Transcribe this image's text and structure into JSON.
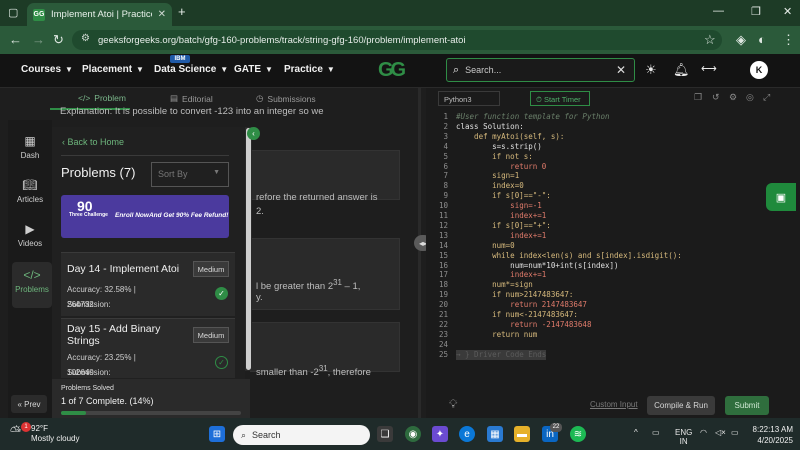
{
  "browser": {
    "tab_title": "Implement Atoi | Practice | GeeksforGeeks",
    "tab_title_display": "Implement Atoi | Practice | Gee",
    "url": "geeksforgeeks.org/batch/gfg-160-problems/track/string-gfg-160/problem/implement-atoi"
  },
  "header": {
    "menu": [
      "Courses",
      "Placement",
      "Data Science",
      "GATE",
      "Practice"
    ],
    "ibm_badge": "IBM",
    "logo": "GG",
    "search_placeholder": "Search...",
    "avatar_letter": "K"
  },
  "problem_tabs": [
    "Problem",
    "Editorial",
    "Submissions"
  ],
  "problem_text": {
    "explanation": "Explanation: It is possible to convert -123 into an integer so we",
    "frag1": "refore the returned answer is",
    "frag1b": "2.",
    "frag2a": "l be greater than 2",
    "frag2sup": "31",
    "frag2b": " – 1,",
    "frag2c": "y.",
    "frag3a": "smaller than -2",
    "frag3sup": "31",
    "frag3b": ", therefore"
  },
  "rail": {
    "items": [
      {
        "label": "Dash",
        "icon": "dashboard-icon"
      },
      {
        "label": "Articles",
        "icon": "articles-icon"
      },
      {
        "label": "Videos",
        "icon": "videos-icon"
      },
      {
        "label": "Problems",
        "icon": "code-icon"
      }
    ],
    "prev_label": "« Prev"
  },
  "panel": {
    "back_label": "Back to Home",
    "title": "Problems (7)",
    "sort_placeholder": "Sort By",
    "banner": {
      "big": "90",
      "small": "Three Challenge",
      "text": "Enroll NowAnd Get 90% Fee Refund!"
    },
    "problems": [
      {
        "title": "Day 14 - Implement Atoi",
        "difficulty": "Medium",
        "accuracy": "Accuracy: 32.58% | Submission:",
        "submissions": "264732",
        "solved": true
      },
      {
        "title": "Day 15 - Add Binary Strings",
        "difficulty": "Medium",
        "accuracy": "Accuracy: 23.25% | Submission:",
        "submissions": "102640",
        "solved": false
      }
    ],
    "solved": {
      "label": "Problems Solved",
      "summary": "1 of 7 Complete. (14%)",
      "fraction": 0.14
    }
  },
  "editor": {
    "language": "Python3",
    "timer": "Start Timer",
    "lines": [
      {
        "n": "1",
        "code": "#User function template for Python",
        "c": "#6a7f6a",
        "i": true
      },
      {
        "n": "2",
        "code": "class Solution:",
        "c": "#e0e0e0"
      },
      {
        "n": "3",
        "code": "    def myAtoi(self, s):",
        "c": "#d7ba7d"
      },
      {
        "n": "4",
        "code": "        s=s.strip()",
        "c": "#e0e0e0"
      },
      {
        "n": "5",
        "code": "        if not s:",
        "c": "#d7ba7d"
      },
      {
        "n": "6",
        "code": "            return 0",
        "c": "#e07b6b"
      },
      {
        "n": "7",
        "code": "        sign=1",
        "c": "#d7ba7d"
      },
      {
        "n": "8",
        "code": "        index=0",
        "c": "#d7ba7d"
      },
      {
        "n": "9",
        "code": "        if s[0]==\"-\":",
        "c": "#d7ba7d"
      },
      {
        "n": "10",
        "code": "            sign=-1",
        "c": "#e07b6b"
      },
      {
        "n": "11",
        "code": "            index+=1",
        "c": "#e07b6b"
      },
      {
        "n": "12",
        "code": "        if s[0]==\"+\":",
        "c": "#d7ba7d"
      },
      {
        "n": "13",
        "code": "            index+=1",
        "c": "#e07b6b"
      },
      {
        "n": "14",
        "code": "        num=0",
        "c": "#d7ba7d"
      },
      {
        "n": "15",
        "code": "        while index<len(s) and s[index].isdigit():",
        "c": "#d7ba7d"
      },
      {
        "n": "16",
        "code": "            num=num*10+int(s[index])",
        "c": "#e0e0e0"
      },
      {
        "n": "17",
        "code": "            index+=1",
        "c": "#e07b6b"
      },
      {
        "n": "18",
        "code": "        num*=sign",
        "c": "#d7ba7d"
      },
      {
        "n": "19",
        "code": "        if num>2147483647:",
        "c": "#d7ba7d"
      },
      {
        "n": "20",
        "code": "            return 2147483647",
        "c": "#e07b6b"
      },
      {
        "n": "21",
        "code": "        if num<-2147483647:",
        "c": "#d7ba7d"
      },
      {
        "n": "22",
        "code": "            return -2147483648",
        "c": "#e07b6b"
      },
      {
        "n": "23",
        "code": "        return num",
        "c": "#d7ba7d"
      },
      {
        "n": "24",
        "code": "",
        "c": "#e0e0e0"
      },
      {
        "n": "25",
        "code": "→ } Driver Code Ends",
        "c": "#5c5c5c"
      }
    ],
    "custom_input": "Custom Input",
    "compile_label": "Compile & Run",
    "submit_label": "Submit"
  },
  "taskbar": {
    "temp": "92°F",
    "condition": "Mostly cloudy",
    "search": "Search",
    "notif_badge": "1",
    "teams_badge": "22",
    "lang1": "ENG",
    "lang2": "IN",
    "time": "8:22:13 AM",
    "date": "4/20/2025"
  },
  "colors": {
    "accent": "#2f8d46",
    "panel": "#202020",
    "editor": "#1b1b1b"
  }
}
